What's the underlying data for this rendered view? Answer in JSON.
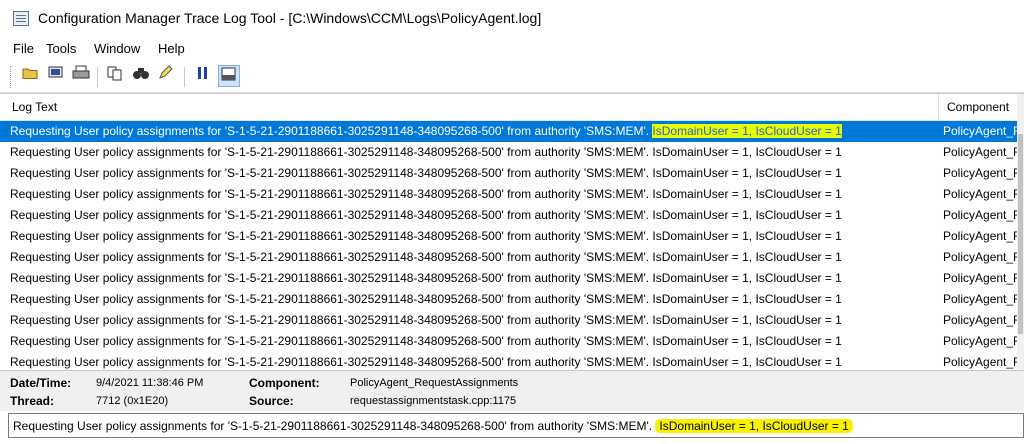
{
  "window": {
    "title": "Configuration Manager Trace Log Tool - [C:\\Windows\\CCM\\Logs\\PolicyAgent.log]"
  },
  "menu": {
    "items": [
      "File",
      "Tools",
      "Window",
      "Help"
    ]
  },
  "toolbar": {
    "buttons": [
      "open-folder-icon",
      "print-preview-icon",
      "print-icon",
      "copy-icon",
      "find-icon",
      "highlight-icon",
      "pause-icon",
      "details-pane-icon"
    ]
  },
  "grid": {
    "columns": {
      "log_text": "Log Text",
      "component": "Component"
    },
    "rows": [
      {
        "pre": "Requesting User policy assignments for 'S-1-5-21-2901188661-3025291148-348095268-500' from authority 'SMS:MEM'. ",
        "hl": "IsDomainUser = 1, IsCloudUser = 1",
        "component": "PolicyAgent_R"
      },
      {
        "pre": "Requesting User policy assignments for 'S-1-5-21-2901188661-3025291148-348095268-500' from authority 'SMS:MEM'. ",
        "hl": "IsDomainUser = 1, IsCloudUser = 1",
        "component": "PolicyAgent_R"
      },
      {
        "pre": "Requesting User policy assignments for 'S-1-5-21-2901188661-3025291148-348095268-500' from authority 'SMS:MEM'. ",
        "hl": "IsDomainUser = 1, IsCloudUser = 1",
        "component": "PolicyAgent_R"
      },
      {
        "pre": "Requesting User policy assignments for 'S-1-5-21-2901188661-3025291148-348095268-500' from authority 'SMS:MEM'. ",
        "hl": "IsDomainUser = 1, IsCloudUser = 1",
        "component": "PolicyAgent_R"
      },
      {
        "pre": "Requesting User policy assignments for 'S-1-5-21-2901188661-3025291148-348095268-500' from authority 'SMS:MEM'. ",
        "hl": "IsDomainUser = 1, IsCloudUser = 1",
        "component": "PolicyAgent_R"
      },
      {
        "pre": "Requesting User policy assignments for 'S-1-5-21-2901188661-3025291148-348095268-500' from authority 'SMS:MEM'. ",
        "hl": "IsDomainUser = 1, IsCloudUser = 1",
        "component": "PolicyAgent_R"
      },
      {
        "pre": "Requesting User policy assignments for 'S-1-5-21-2901188661-3025291148-348095268-500' from authority 'SMS:MEM'. ",
        "hl": "IsDomainUser = 1, IsCloudUser = 1",
        "component": "PolicyAgent_R"
      },
      {
        "pre": "Requesting User policy assignments for 'S-1-5-21-2901188661-3025291148-348095268-500' from authority 'SMS:MEM'. ",
        "hl": "IsDomainUser = 1, IsCloudUser = 1",
        "component": "PolicyAgent_R"
      },
      {
        "pre": "Requesting User policy assignments for 'S-1-5-21-2901188661-3025291148-348095268-500' from authority 'SMS:MEM'. ",
        "hl": "IsDomainUser = 1, IsCloudUser = 1",
        "component": "PolicyAgent_R"
      },
      {
        "pre": "Requesting User policy assignments for 'S-1-5-21-2901188661-3025291148-348095268-500' from authority 'SMS:MEM'. ",
        "hl": "IsDomainUser = 1, IsCloudUser = 1",
        "component": "PolicyAgent_R"
      },
      {
        "pre": "Requesting User policy assignments for 'S-1-5-21-2901188661-3025291148-348095268-500' from authority 'SMS:MEM'. ",
        "hl": "IsDomainUser = 1, IsCloudUser = 1",
        "component": "PolicyAgent_R"
      },
      {
        "pre": "Requesting User policy assignments for 'S-1-5-21-2901188661-3025291148-348095268-500' from authority 'SMS:MEM'. ",
        "hl": "IsDomainUser = 1, IsCloudUser = 1",
        "component": "PolicyAgent_R"
      }
    ]
  },
  "details": {
    "datetime_label": "Date/Time:",
    "datetime_value": "9/4/2021 11:38:46 PM",
    "component_label": "Component:",
    "component_value": "PolicyAgent_RequestAssignments",
    "thread_label": "Thread:",
    "thread_value": "7712 (0x1E20)",
    "source_label": "Source:",
    "source_value": "requestassignmentstask.cpp:1175"
  },
  "message": {
    "pre": "Requesting User policy assignments for 'S-1-5-21-2901188661-3025291148-348095268-500' from authority 'SMS:MEM'.",
    "hl": "IsDomainUser = 1, IsCloudUser = 1"
  },
  "colors": {
    "selection": "#0078d7",
    "highlight": "#e7ff00"
  }
}
